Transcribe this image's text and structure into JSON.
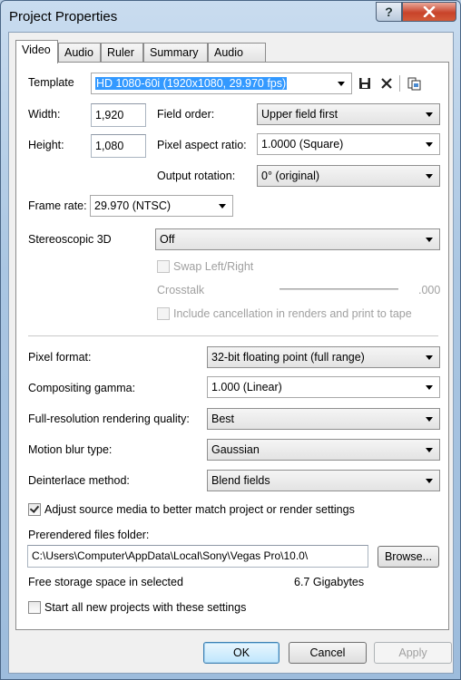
{
  "window": {
    "title": "Project Properties"
  },
  "tabs": [
    "Video",
    "Audio",
    "Ruler",
    "Summary",
    "Audio CD"
  ],
  "template": {
    "label": "Template",
    "value": "HD 1080-60i (1920x1080, 29.970 fps)"
  },
  "width": {
    "label": "Width:",
    "value": "1,920"
  },
  "height": {
    "label": "Height:",
    "value": "1,080"
  },
  "field_order": {
    "label": "Field order:",
    "value": "Upper field first"
  },
  "pixel_aspect": {
    "label": "Pixel aspect ratio:",
    "value": "1.0000 (Square)"
  },
  "output_rotation": {
    "label": "Output rotation:",
    "value": "0° (original)"
  },
  "frame_rate": {
    "label": "Frame rate:",
    "value": "29.970 (NTSC)"
  },
  "stereoscopic": {
    "label": "Stereoscopic 3D",
    "value": "Off"
  },
  "swap": {
    "label": "Swap Left/Right",
    "checked": false
  },
  "crosstalk": {
    "label": "Crosstalk",
    "value": ".000"
  },
  "include_cancel": {
    "label": "Include cancellation in renders and print to tape",
    "checked": false
  },
  "pixel_format": {
    "label": "Pixel format:",
    "value": "32-bit floating point (full range)"
  },
  "compositing_gamma": {
    "label": "Compositing gamma:",
    "value": "1.000 (Linear)"
  },
  "render_quality": {
    "label": "Full-resolution rendering quality:",
    "value": "Best"
  },
  "motion_blur": {
    "label": "Motion blur type:",
    "value": "Gaussian"
  },
  "deinterlace": {
    "label": "Deinterlace method:",
    "value": "Blend fields"
  },
  "adjust_source": {
    "label": "Adjust source media to better match project or render settings",
    "checked": true
  },
  "prerender": {
    "label": "Prerendered files folder:",
    "value": "C:\\Users\\Computer\\AppData\\Local\\Sony\\Vegas Pro\\10.0\\",
    "browse": "Browse..."
  },
  "free_space": {
    "label": "Free storage space in selected",
    "value": "6.7 Gigabytes"
  },
  "start_all": {
    "label": "Start all new projects with these settings",
    "checked": false
  },
  "buttons": {
    "ok": "OK",
    "cancel": "Cancel",
    "apply": "Apply"
  }
}
